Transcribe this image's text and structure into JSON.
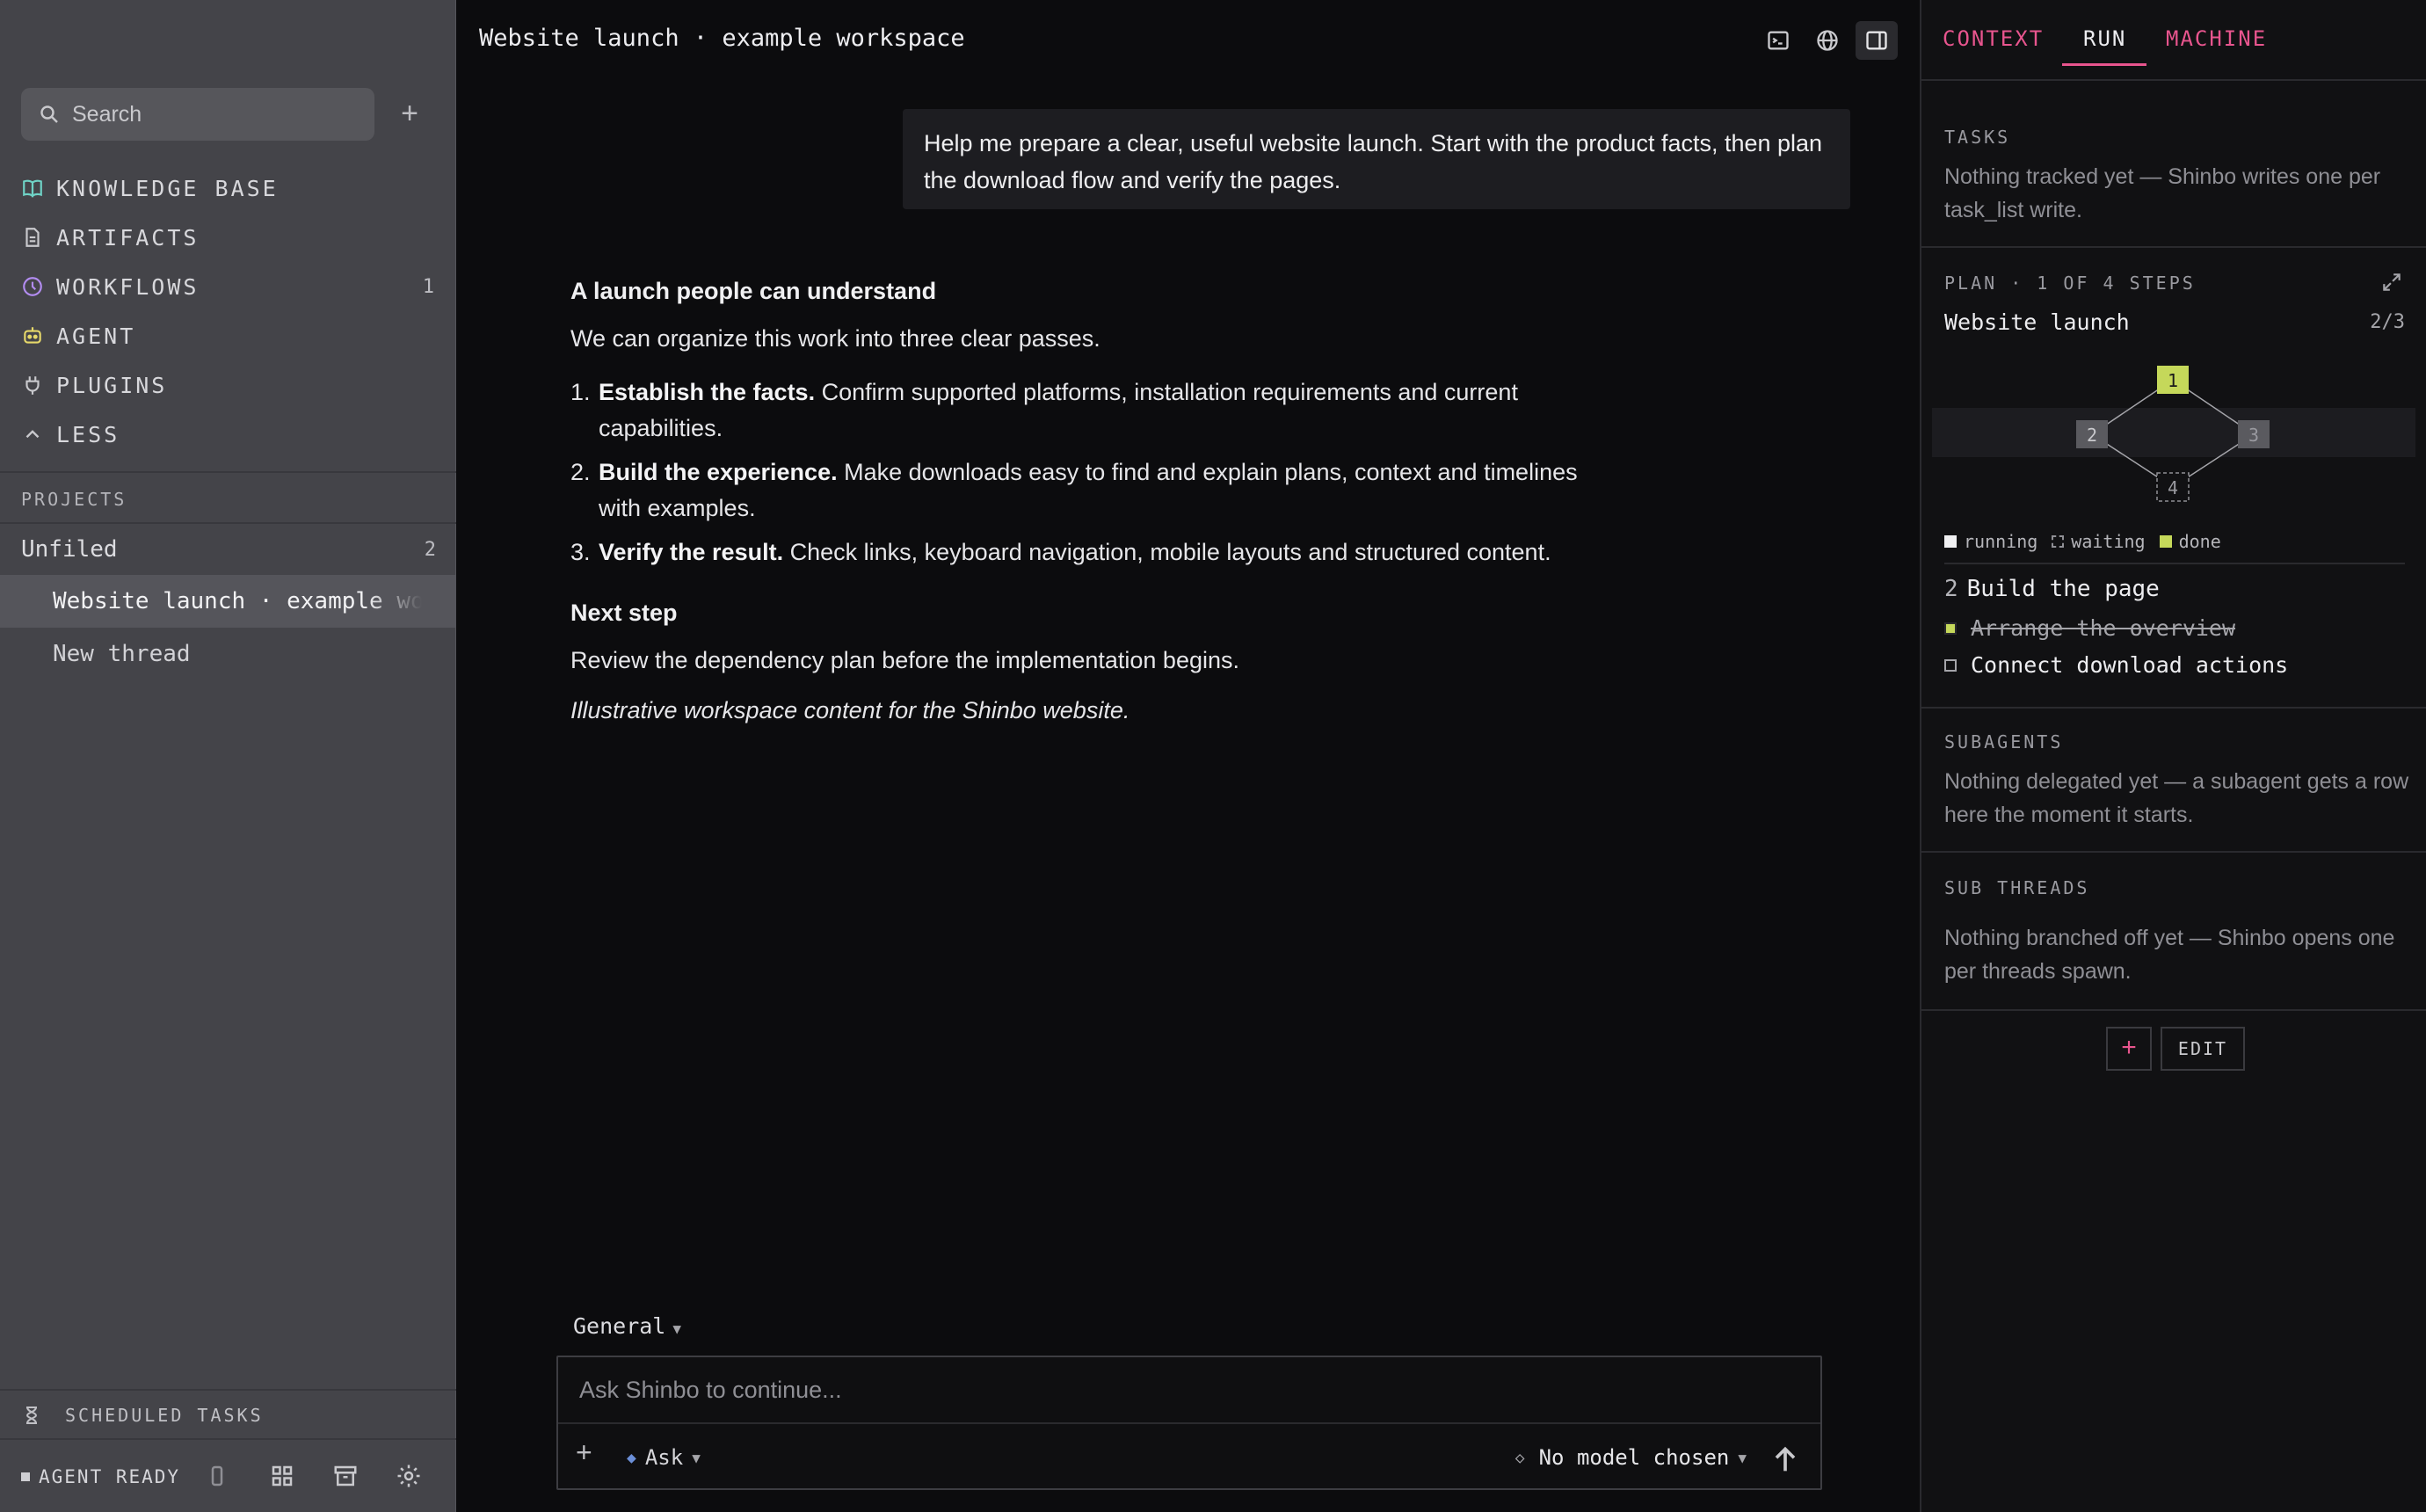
{
  "sidebar": {
    "search_placeholder": "Search",
    "new_label": "+",
    "nav": [
      {
        "label": "KNOWLEDGE BASE",
        "count": ""
      },
      {
        "label": "ARTIFACTS",
        "count": ""
      },
      {
        "label": "WORKFLOWS",
        "count": "1"
      },
      {
        "label": "AGENT",
        "count": ""
      },
      {
        "label": "PLUGINS",
        "count": ""
      },
      {
        "label": "LESS",
        "count": ""
      }
    ],
    "projects_label": "PROJECTS",
    "group": {
      "label": "Unfiled",
      "count": "2"
    },
    "threads": [
      "Website launch · example workspace",
      "New thread"
    ],
    "scheduled_label": "SCHEDULED TASKS",
    "status_label": "AGENT READY"
  },
  "main": {
    "title": "Website launch · example workspace",
    "user_message": "Help me prepare a clear, useful website launch. Start with the product facts, then plan the download flow and verify the pages.",
    "reply": {
      "heading1": "A launch people can understand",
      "intro": "We can organize this work into three clear passes.",
      "items": [
        {
          "num": "1.",
          "bold": "Establish the facts.",
          "text": " Confirm supported platforms, installation requirements and current capabilities."
        },
        {
          "num": "2.",
          "bold": "Build the experience.",
          "text": " Make downloads easy to find and explain plans, context and timelines with examples."
        },
        {
          "num": "3.",
          "bold": "Verify the result.",
          "text": " Check links, keyboard navigation, mobile layouts and structured content."
        }
      ],
      "heading2": "Next step",
      "next_text": "Review the dependency plan before the implementation begins.",
      "footnote": "Illustrative workspace content for the Shinbo website."
    },
    "mode": "General",
    "composer_placeholder": "Ask Shinbo to continue...",
    "ask_label": "Ask",
    "model_label": "No model chosen"
  },
  "panel": {
    "tabs": [
      "CONTEXT",
      "RUN",
      "MACHINE"
    ],
    "tasks_label": "TASKS",
    "tasks_text": "Nothing tracked yet — Shinbo writes one per task_list write.",
    "plan_label": "PLAN · 1 OF 4 STEPS",
    "plan_title": "Website launch",
    "plan_progress": "2/3",
    "graph_nodes": [
      "1",
      "2",
      "3",
      "4"
    ],
    "legend": [
      "running",
      "waiting",
      "done"
    ],
    "step_num": "2",
    "step_title": "Build the page",
    "substeps": [
      "Arrange the overview",
      "Connect download actions"
    ],
    "subagents_label": "SUBAGENTS",
    "subagents_text": "Nothing delegated yet — a subagent gets a row here the moment it starts.",
    "subthreads_label": "SUB THREADS",
    "subthreads_text": "Nothing branched off yet — Shinbo opens one per threads spawn.",
    "add_label": "+",
    "edit_label": "EDIT"
  },
  "colors": {
    "accent": "#e8558e",
    "done": "#c5d85a",
    "sidebar": "#444449"
  }
}
